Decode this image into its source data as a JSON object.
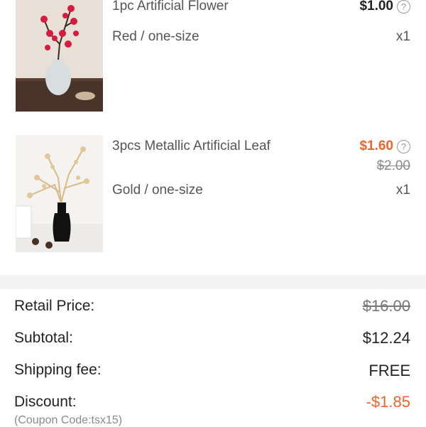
{
  "colors": {
    "accent": "#f0632a",
    "muted": "#8a8a8a",
    "text": "#222222"
  },
  "items": [
    {
      "name": "1pc Artificial Flower",
      "variant": "Red / one-size",
      "price": "$1.00",
      "original_price": null,
      "quantity": "x1",
      "image_icon": "red-plum-blossom-vase"
    },
    {
      "name": "3pcs Metallic Artificial Leaf",
      "variant": "Gold / one-size",
      "price": "$1.60",
      "original_price": "$2.00",
      "quantity": "x1",
      "image_icon": "gold-leaf-vase"
    }
  ],
  "help_glyph": "?",
  "summary": {
    "retail_price": {
      "label": "Retail Price:",
      "value": "$16.00"
    },
    "subtotal": {
      "label": "Subtotal:",
      "value": "$12.24"
    },
    "shipping": {
      "label": "Shipping fee:",
      "value": "FREE"
    },
    "discount": {
      "label": "Discount:",
      "value": "-$1.85",
      "note": "(Coupon Code:tsx15)"
    }
  }
}
